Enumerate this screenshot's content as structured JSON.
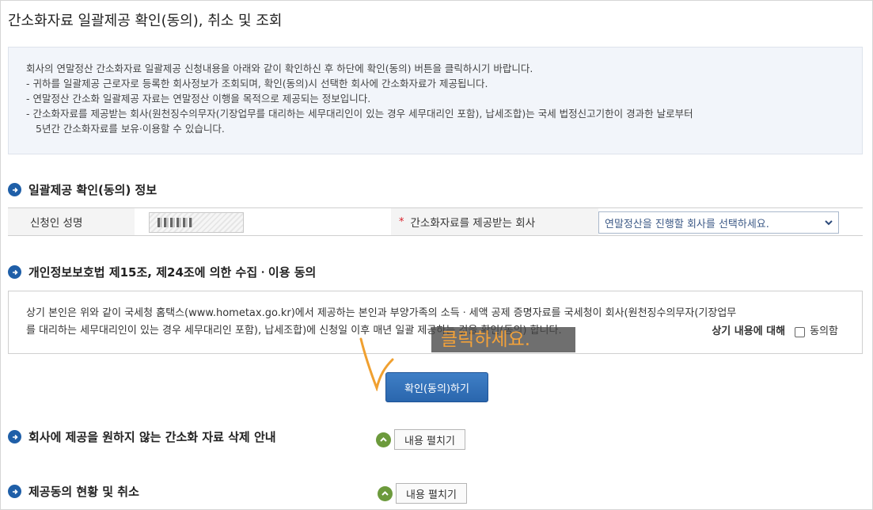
{
  "page": {
    "title": "간소화자료 일괄제공 확인(동의), 취소 및 조회"
  },
  "notice": {
    "lines": [
      "회사의 연말정산 간소화자료 일괄제공 신청내용을 아래와 같이 확인하신 후 하단에 확인(동의) 버튼을 클릭하시기 바랍니다.",
      "- 귀하를 일괄제공 근로자로 등록한 회사정보가 조회되며, 확인(동의)시 선택한 회사에 간소화자료가 제공됩니다.",
      "- 연말정산 간소화 일괄제공 자료는 연말정산 이행을 목적으로 제공되는 정보입니다.",
      "- 간소화자료를 제공받는 회사(원천징수의무자(기장업무를 대리하는 세무대리인이 있는 경우 세무대리인 포함), 납세조합)는 국세 법정신고기한이 경과한 날로부터",
      "5년간 간소화자료를 보유·이용할 수 있습니다."
    ]
  },
  "info_section": {
    "title": "일괄제공 확인(동의) 정보",
    "applicant_label": "신청인 성명",
    "company_label": "간소화자료를 제공받는 회사",
    "required_mark": "*",
    "company_select_value": "연말정산을 진행할 회사를 선택하세요."
  },
  "consent_section": {
    "title": "개인정보보호법 제15조, 제24조에 의한 수집ㆍ이용 동의",
    "text_lines": [
      "상기 본인은 위와 같이 국세청 홈택스(www.hometax.go.kr)에서 제공하는 본인과 부양가족의 소득ㆍ세액 공제 증명자료를 국세청이 회사(원천징수의무자(기장업무",
      "를 대리하는 세무대리인이 있는 경우 세무대리인 포함), 납세조합)에 신청일 이후 매년 일괄 제공하는 것을 확인(동의) 합니다."
    ],
    "agree_prefix": "상기 내용에 대해",
    "agree_label": "동의함",
    "agree_checked": false
  },
  "callout": {
    "text": "클릭하세요."
  },
  "confirm_button": {
    "label": "확인(동의)하기"
  },
  "deletion_section": {
    "title": "회사에 제공을 원하지 않는 간소화 자료 삭제 안내",
    "toggle_label": "내용 펼치기"
  },
  "status_section": {
    "title": "제공동의 현황 및 취소",
    "toggle_label": "내용 펼치기"
  },
  "colors": {
    "accent": "#1f5fa8",
    "required": "#d9202a",
    "callout_text": "#f3a23a",
    "toggle_icon": "#6c9a3c"
  },
  "icons": {
    "section_bullet": "arrow-right-circle-icon",
    "select_arrow": "chevron-down-icon",
    "toggle": "chevron-up-circle-icon"
  }
}
